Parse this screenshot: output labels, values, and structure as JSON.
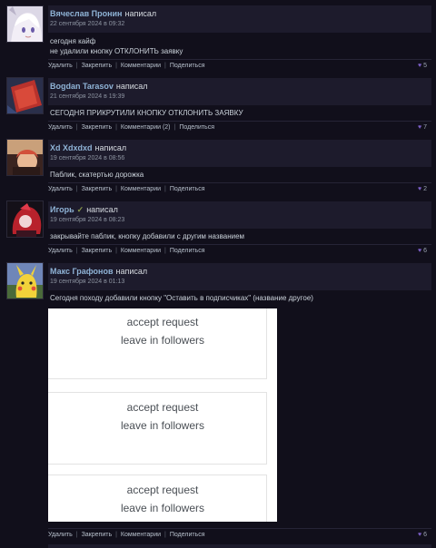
{
  "posts": [
    {
      "author": "Вячеслав Пронин",
      "wrote": "написал",
      "date": "22 сентября 2024 в 09:32",
      "lines": [
        "сегодня кайф",
        "не удалили кнопку ОТКЛОНИТЬ заявку"
      ],
      "actions": [
        "Удалить",
        "Закрепить",
        "Комментарии",
        "Поделиться"
      ],
      "likes": "5"
    },
    {
      "author": "Bogdan Tarasov",
      "wrote": "написал",
      "date": "21 сентября 2024 в 19:39",
      "lines": [
        "СЕГОДНЯ ПРИКРУТИЛИ КНОПКУ ОТКЛОНИТЬ ЗАЯВКУ"
      ],
      "actions": [
        "Удалить",
        "Закрепить",
        "Комментарии (2)",
        "Поделиться"
      ],
      "likes": "7"
    },
    {
      "author": "Xd Xdxdxd",
      "wrote": "написал",
      "date": "19 сентября 2024 в 08:56",
      "lines": [
        "Паблик, скатертью дорожка"
      ],
      "actions": [
        "Удалить",
        "Закрепить",
        "Комментарии",
        "Поделиться"
      ],
      "likes": "2"
    },
    {
      "author": "Игорь",
      "check": "✓",
      "wrote": "написал",
      "date": "19 сентября 2024 в 08:23",
      "lines": [
        "закрывайте паблик, кнопку добавили с другим названием"
      ],
      "actions": [
        "Удалить",
        "Закрепить",
        "Комментарии",
        "Поделиться"
      ],
      "likes": "6"
    },
    {
      "author": "Макс Графонов",
      "wrote": "написал",
      "date": "19 сентября 2024 в 01:13",
      "lines": [
        "Сегодня походу добавили кнопку \"Оставить в подписчиках\" (название другое)"
      ],
      "actions": [
        "Удалить",
        "Закрепить",
        "Комментарии",
        "Поделиться"
      ],
      "likes": "6"
    }
  ],
  "screenshot_cards": [
    {
      "accept": "accept request",
      "leave": "leave in followers"
    },
    {
      "accept": "accept request",
      "leave": "leave in followers"
    },
    {
      "accept": "accept request",
      "leave": "leave in followers"
    }
  ],
  "colors": {
    "background": "#110f1b",
    "header": "#1d1b2c",
    "author_link": "#8fb3d6",
    "heart": "#7b5fc7"
  }
}
